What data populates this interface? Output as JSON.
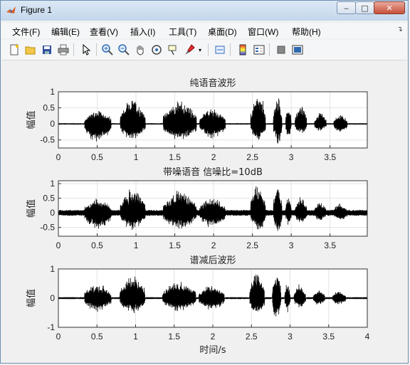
{
  "window": {
    "title": "Figure 1"
  },
  "menu": [
    "文件(F)",
    "编辑(E)",
    "查看(V)",
    "插入(I)",
    "工具(T)",
    "桌面(D)",
    "窗口(W)",
    "帮助(H)"
  ],
  "toolbar": [
    "new-figure-icon",
    "open-file-icon",
    "save-icon",
    "print-icon",
    "pointer-icon",
    "zoom-in-icon",
    "zoom-out-icon",
    "pan-icon",
    "rotate-3d-icon",
    "data-cursor-icon",
    "brush-icon",
    "link-icon",
    "colorbar-icon",
    "legend-icon",
    "hide-plot-tools-icon",
    "show-plot-tools-icon"
  ],
  "chart_data": [
    {
      "type": "line",
      "title": "纯语音波形",
      "ylabel": "幅值",
      "xlabel": "",
      "xlim": [
        0,
        3.98
      ],
      "ylim": [
        -0.75,
        1
      ],
      "xticks": [
        "0",
        "0.5",
        "1",
        "1.5",
        "2",
        "2.5",
        "3",
        "3.5"
      ],
      "yticks": [
        "1",
        "0.5",
        "0",
        "-0.5"
      ],
      "grid": true,
      "series": [
        {
          "color": "#000000",
          "segments": [
            {
              "x": [
                0.34,
                0.68
              ],
              "amp": [
                0.45,
                -0.6
              ]
            },
            {
              "x": [
                0.8,
                1.12
              ],
              "amp": [
                0.8,
                -0.55
              ]
            },
            {
              "x": [
                1.35,
                1.78
              ],
              "amp": [
                0.75,
                -0.55
              ]
            },
            {
              "x": [
                1.82,
                2.15
              ],
              "amp": [
                0.5,
                -0.5
              ]
            },
            {
              "x": [
                2.48,
                2.67
              ],
              "amp": [
                1.0,
                -0.55
              ]
            },
            {
              "x": [
                2.77,
                2.88
              ],
              "amp": [
                0.9,
                -0.7
              ]
            },
            {
              "x": [
                2.93,
                3.0
              ],
              "amp": [
                0.6,
                -0.45
              ]
            },
            {
              "x": [
                3.05,
                3.2
              ],
              "amp": [
                0.6,
                -0.35
              ]
            },
            {
              "x": [
                3.3,
                3.45
              ],
              "amp": [
                0.35,
                -0.25
              ]
            },
            {
              "x": [
                3.55,
                3.72
              ],
              "amp": [
                0.3,
                -0.3
              ]
            }
          ]
        }
      ]
    },
    {
      "type": "line",
      "title": "带噪语音 信噪比=10dB",
      "ylabel": "幅值",
      "xlabel": "",
      "xlim": [
        0,
        3.98
      ],
      "ylim": [
        -0.8,
        1.1
      ],
      "xticks": [
        "0",
        "0.5",
        "1",
        "1.5",
        "2",
        "2.5",
        "3",
        "3.5"
      ],
      "yticks": [
        "1",
        "0.5",
        "0",
        "-0.5"
      ],
      "grid": true,
      "series": [
        {
          "color": "#000000",
          "noise": 0.1,
          "segments": [
            {
              "x": [
                0.34,
                0.68
              ],
              "amp": [
                0.55,
                -0.6
              ]
            },
            {
              "x": [
                0.8,
                1.12
              ],
              "amp": [
                0.85,
                -0.6
              ]
            },
            {
              "x": [
                1.35,
                1.78
              ],
              "amp": [
                0.8,
                -0.6
              ]
            },
            {
              "x": [
                1.82,
                2.15
              ],
              "amp": [
                0.55,
                -0.55
              ]
            },
            {
              "x": [
                2.48,
                2.67
              ],
              "amp": [
                1.05,
                -0.65
              ]
            },
            {
              "x": [
                2.77,
                2.88
              ],
              "amp": [
                1.0,
                -0.7
              ]
            },
            {
              "x": [
                2.93,
                3.0
              ],
              "amp": [
                0.65,
                -0.5
              ]
            },
            {
              "x": [
                3.05,
                3.2
              ],
              "amp": [
                0.6,
                -0.4
              ]
            },
            {
              "x": [
                3.3,
                3.45
              ],
              "amp": [
                0.4,
                -0.3
              ]
            },
            {
              "x": [
                3.55,
                3.72
              ],
              "amp": [
                0.35,
                -0.3
              ]
            }
          ]
        }
      ]
    },
    {
      "type": "line",
      "title": "谱减后波形",
      "ylabel": "幅值",
      "xlabel": "时间/s",
      "xlim": [
        0,
        4
      ],
      "ylim": [
        -1,
        1
      ],
      "xticks": [
        "0",
        "0.5",
        "1",
        "1.5",
        "2",
        "2.5",
        "3",
        "3.5",
        "4"
      ],
      "yticks": [
        "1",
        "0",
        "-1"
      ],
      "grid": true,
      "series": [
        {
          "color": "#000000",
          "noise": 0.01,
          "segments": [
            {
              "x": [
                0.34,
                0.68
              ],
              "amp": [
                0.5,
                -0.5
              ]
            },
            {
              "x": [
                0.8,
                1.12
              ],
              "amp": [
                0.8,
                -0.55
              ]
            },
            {
              "x": [
                1.35,
                1.78
              ],
              "amp": [
                0.6,
                -0.5
              ]
            },
            {
              "x": [
                1.82,
                2.15
              ],
              "amp": [
                0.45,
                -0.45
              ]
            },
            {
              "x": [
                2.48,
                2.67
              ],
              "amp": [
                0.95,
                -0.6
              ]
            },
            {
              "x": [
                2.77,
                2.88
              ],
              "amp": [
                0.9,
                -0.75
              ]
            },
            {
              "x": [
                2.93,
                3.0
              ],
              "amp": [
                0.55,
                -0.5
              ]
            },
            {
              "x": [
                3.05,
                3.2
              ],
              "amp": [
                0.5,
                -0.35
              ]
            },
            {
              "x": [
                3.3,
                3.45
              ],
              "amp": [
                0.3,
                -0.25
              ]
            },
            {
              "x": [
                3.55,
                3.72
              ],
              "amp": [
                0.25,
                -0.25
              ]
            }
          ]
        }
      ]
    }
  ]
}
